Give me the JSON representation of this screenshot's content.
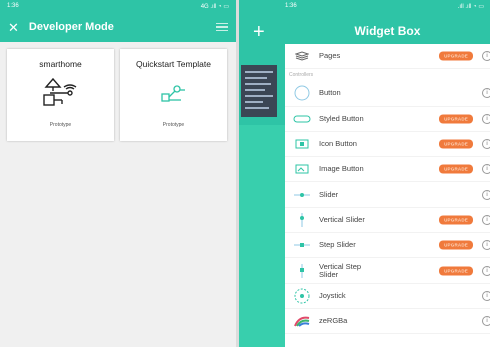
{
  "left_phone": {
    "status_time": "1:36",
    "status_right": "4G .ıll ◔ ▭",
    "title": "Developer Mode",
    "cards": [
      {
        "title": "smarthome",
        "caption": "Prototype",
        "icon": "device-cluster-icon"
      },
      {
        "title": "Quickstart Template",
        "caption": "Prototype",
        "icon": "chip-icon"
      }
    ]
  },
  "right_phone": {
    "status_time": "1:36",
    "status_right": ".ıll .ıll ◔ ▭",
    "title": "Widget Box",
    "section_label": "Controllers",
    "upgrade_label": "UPGRADE",
    "pages_label": "Pages",
    "widgets": [
      {
        "label": "Button",
        "upgrade": false,
        "icon": "button-icon"
      },
      {
        "label": "Styled Button",
        "upgrade": true,
        "icon": "styled-button-icon"
      },
      {
        "label": "Icon Button",
        "upgrade": true,
        "icon": "icon-button-icon"
      },
      {
        "label": "Image Button",
        "upgrade": true,
        "icon": "image-button-icon"
      },
      {
        "label": "Slider",
        "upgrade": false,
        "icon": "slider-icon"
      },
      {
        "label": "Vertical Slider",
        "upgrade": true,
        "icon": "vertical-slider-icon"
      },
      {
        "label": "Step Slider",
        "upgrade": true,
        "icon": "step-slider-icon"
      },
      {
        "label": "Vertical Step Slider",
        "upgrade": true,
        "icon": "vertical-step-slider-icon"
      },
      {
        "label": "Joystick",
        "upgrade": false,
        "icon": "joystick-icon"
      },
      {
        "label": "zeRGBa",
        "upgrade": false,
        "icon": "zergba-icon"
      }
    ]
  },
  "colors": {
    "teal": "#2ec4a6",
    "upgrade": "#f07a3c"
  }
}
